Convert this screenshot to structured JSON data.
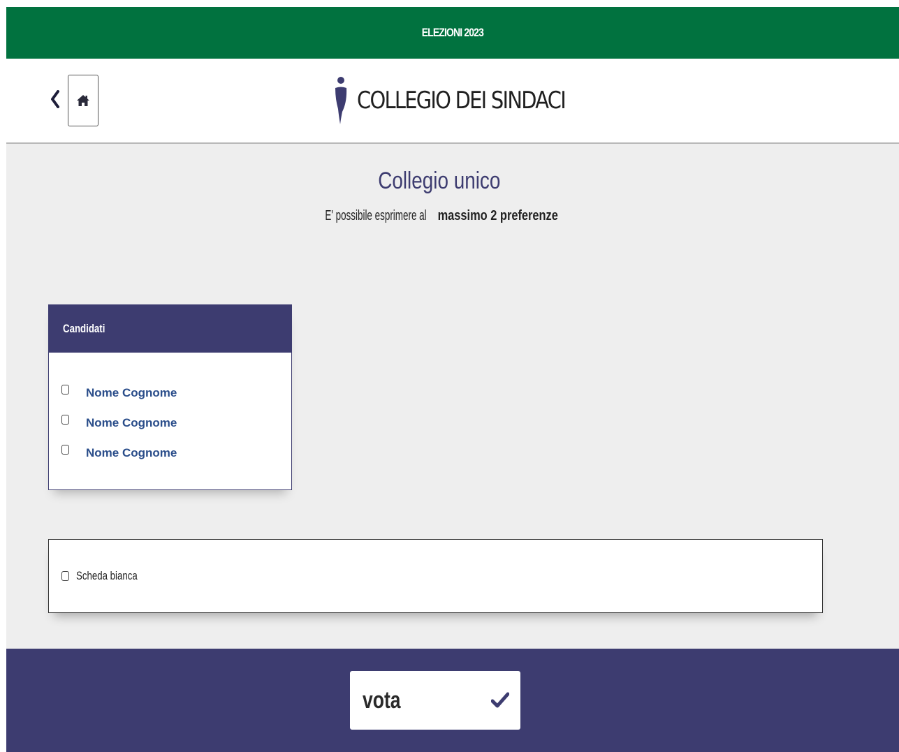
{
  "banner": {
    "title": "ELEZIONI 2023"
  },
  "header": {
    "back_icon": "chevron-left-icon",
    "home_icon": "home-icon",
    "logo_icon": "person-i-logo",
    "title": "COLLEGIO DEI SINDACI"
  },
  "section": {
    "title": "Collegio unico",
    "subtitle_prefix": "E' possibile esprimere al ",
    "subtitle_bold": "massimo 2 preferenze"
  },
  "candidates": {
    "heading": "Candidati",
    "items": [
      {
        "name": "Nome Cognome",
        "checked": false
      },
      {
        "name": "Nome Cognome",
        "checked": false
      },
      {
        "name": "Nome Cognome",
        "checked": false
      }
    ]
  },
  "blank_ballot": {
    "label": "Scheda bianca",
    "checked": false
  },
  "footer": {
    "vote_label": "vota",
    "vote_icon": "checkmark-icon"
  },
  "colors": {
    "banner_green": "#01723f",
    "brand_navy": "#3d3c70",
    "candidate_blue": "#2a4d8a",
    "content_gray": "#eeeeee"
  }
}
